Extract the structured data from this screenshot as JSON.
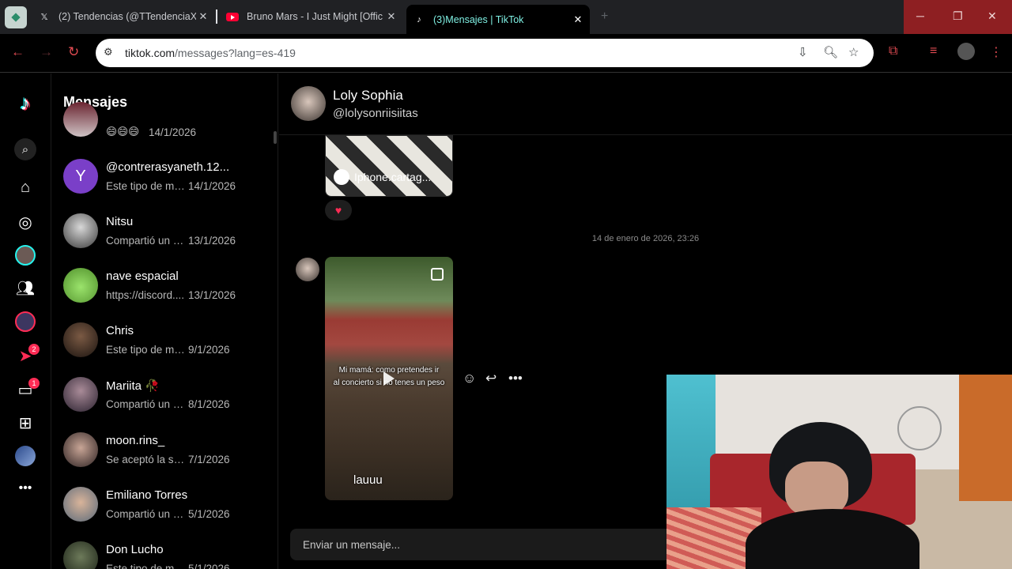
{
  "browser": {
    "tabs": [
      {
        "title": "(2) Tendencias (@TTendenciaX",
        "icon": "x-logo-icon"
      },
      {
        "title": "Bruno Mars - I Just Might [Offic",
        "icon": "youtube-icon"
      },
      {
        "title": "(3)Mensajes | TikTok",
        "icon": "tiktok-icon",
        "active": true
      }
    ],
    "new_tab": "+",
    "url_host": "tiktok.com",
    "url_path": "/messages?lang=es-419"
  },
  "tiktok": {
    "rail_badges": {
      "activity": "2",
      "messages": "1"
    },
    "messages_title": "Mensajes",
    "conversations": [
      {
        "name": "",
        "preview": "😄😄😄",
        "date": "14/1/2026"
      },
      {
        "name": "@contrerasyaneth.12...",
        "preview": "Este tipo de me...",
        "date": "14/1/2026",
        "initial": "Y"
      },
      {
        "name": "Nitsu",
        "preview": "Compartió un vi...",
        "date": "13/1/2026"
      },
      {
        "name": "nave espacial",
        "preview": "https://discord....",
        "date": "13/1/2026"
      },
      {
        "name": "Chris",
        "preview": "Este tipo de men...",
        "date": "9/1/2026"
      },
      {
        "name": "Mariita 🥀",
        "preview": "Compartió un vi...",
        "date": "8/1/2026"
      },
      {
        "name": "moon.rins_",
        "preview": "Se aceptó la soli...",
        "date": "7/1/2026"
      },
      {
        "name": "Emiliano Torres",
        "preview": "Compartió un vi...",
        "date": "5/1/2026"
      },
      {
        "name": "Don Lucho",
        "preview": "Este tipo de men...",
        "date": "5/1/2026"
      }
    ],
    "chat": {
      "name": "Loly Sophia",
      "username": "@lolysonriisiitas",
      "shared_card_label": "Iphone.cartag...",
      "reaction": "♥",
      "date_separator": "14 de enero de 2026, 23:26",
      "video_overlay_line1": "Mi mamá: como pretendes ir",
      "video_overlay_line2": "al concierto si no tenes un peso",
      "video_caption": "lauuu",
      "compose_placeholder": "Enviar un mensaje..."
    }
  },
  "colors": {
    "tiktok_red": "#fe2c55",
    "active_tab_text": "#7ff0e3",
    "window_controls_bg": "#8e1f22"
  }
}
